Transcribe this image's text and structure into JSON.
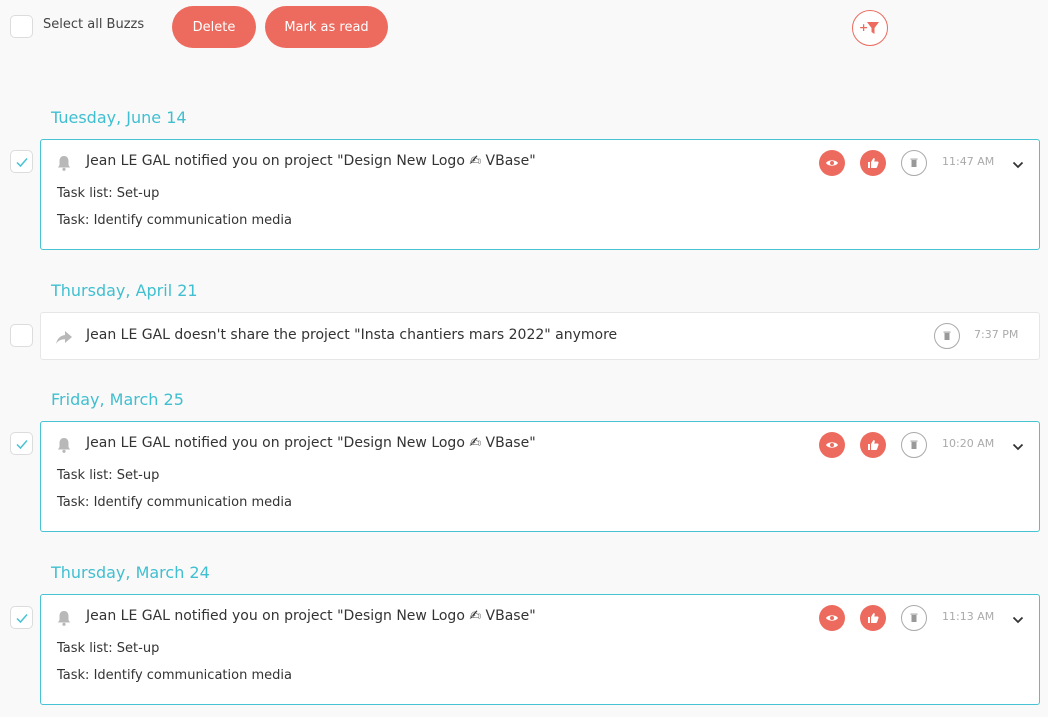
{
  "toolbar": {
    "select_all_label": "Select all Buzzs",
    "delete_label": "Delete",
    "mark_read_label": "Mark as read",
    "filter_plus": "+"
  },
  "groups": [
    {
      "date": "Tuesday, June 14",
      "checked": true,
      "title": "Jean LE GAL notified you on project \"Design New Logo ✍ VBase\"",
      "task_list": "Task list: Set-up",
      "task": "Task: Identify communication media",
      "time": "11:47 AM"
    },
    {
      "date": "Thursday, April 21",
      "checked": false,
      "title": "Jean LE GAL doesn't share the project \"Insta chantiers mars 2022\" anymore",
      "time": "7:37 PM"
    },
    {
      "date": "Friday, March 25",
      "checked": true,
      "title": "Jean LE GAL notified you on project \"Design New Logo ✍ VBase\"",
      "task_list": "Task list: Set-up",
      "task": "Task: Identify communication media",
      "time": "10:20 AM"
    },
    {
      "date": "Thursday, March 24",
      "checked": true,
      "title": "Jean LE GAL notified you on project \"Design New Logo ✍ VBase\"",
      "task_list": "Task list: Set-up",
      "task": "Task: Identify communication media",
      "time": "11:13 AM"
    }
  ],
  "colors": {
    "accent": "#ec6b5e",
    "teal": "#3fbfd0"
  }
}
